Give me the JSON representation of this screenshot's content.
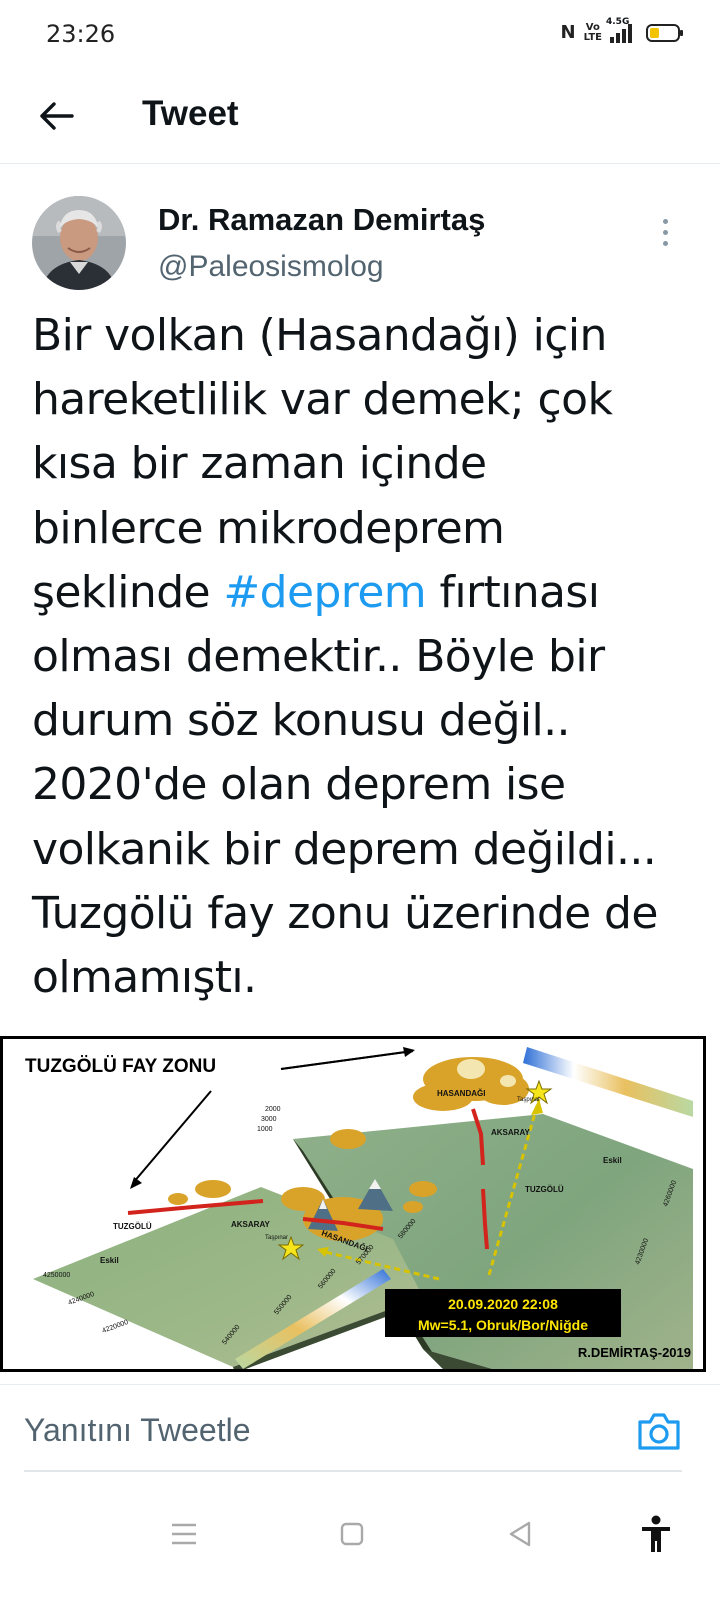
{
  "status_bar": {
    "time": "23:26",
    "volte": "Vo\nLTE",
    "network": "4.5G",
    "battery_level": 0.35,
    "battery_color": "#f2c300"
  },
  "header": {
    "title": "Tweet",
    "back_icon": "arrow-left-icon"
  },
  "tweet": {
    "author_name": "Dr. Ramazan Demirtaş",
    "author_handle": "@Paleosismolog",
    "text_lines": [
      "Bir volkan (Hasandağı) için",
      "hareketlilik var demek; çok",
      "kısa bir zaman içinde",
      "binlerce mikrodeprem",
      [
        "şeklinde ",
        "#deprem",
        " fırtınası"
      ],
      "olması demektir.. Böyle bir",
      "durum söz konusu değil..",
      "2020'de olan deprem ise",
      "volkanik bir deprem değildi...",
      "Tuzgölü fay zonu üzerinde de",
      "olmamıştı."
    ],
    "hashtag": "#deprem",
    "hashtag_color": "#1d9bf0"
  },
  "media": {
    "title": "TUZGÖLÜ FAY ZONU",
    "labels": {
      "hasandagi_far": "HASANDAĞI",
      "hasandagi_near": "HASANDAĞI",
      "aksaray_far": "AKSARAY",
      "aksaray_near": "AKSARAY",
      "tuzgolu_far": "TUZGÖLÜ",
      "tuzgolu_near": "TUZGÖLÜ",
      "eskil_far": "Eskil",
      "eskil_near": "Eskil",
      "taspinar_far": "Taşpınar",
      "taspinar_near": "Taşpınar"
    },
    "elevation_ticks": [
      "2000",
      "3000",
      "1000"
    ],
    "coord_ticks": [
      "4250000",
      "4240000",
      "4220000",
      "540000",
      "550000",
      "560000",
      "570000",
      "580000",
      "4230000",
      "4260000"
    ],
    "event_date": "20.09.2020 22:08",
    "event_info": "Mw=5.1, Obruk/Bor/Niğde",
    "credit": "R.DEMİRTAŞ-2019",
    "event_box_bg": "#000000",
    "event_text_color": "#ffe600"
  },
  "reply": {
    "placeholder": "Yanıtını Tweetle",
    "camera_icon": "camera-icon",
    "accent": "#1d9bf0"
  },
  "nav": {
    "recents_icon": "menu-lines-icon",
    "home_icon": "square-icon",
    "back_icon": "triangle-back-icon",
    "accessibility_icon": "accessibility-icon"
  }
}
